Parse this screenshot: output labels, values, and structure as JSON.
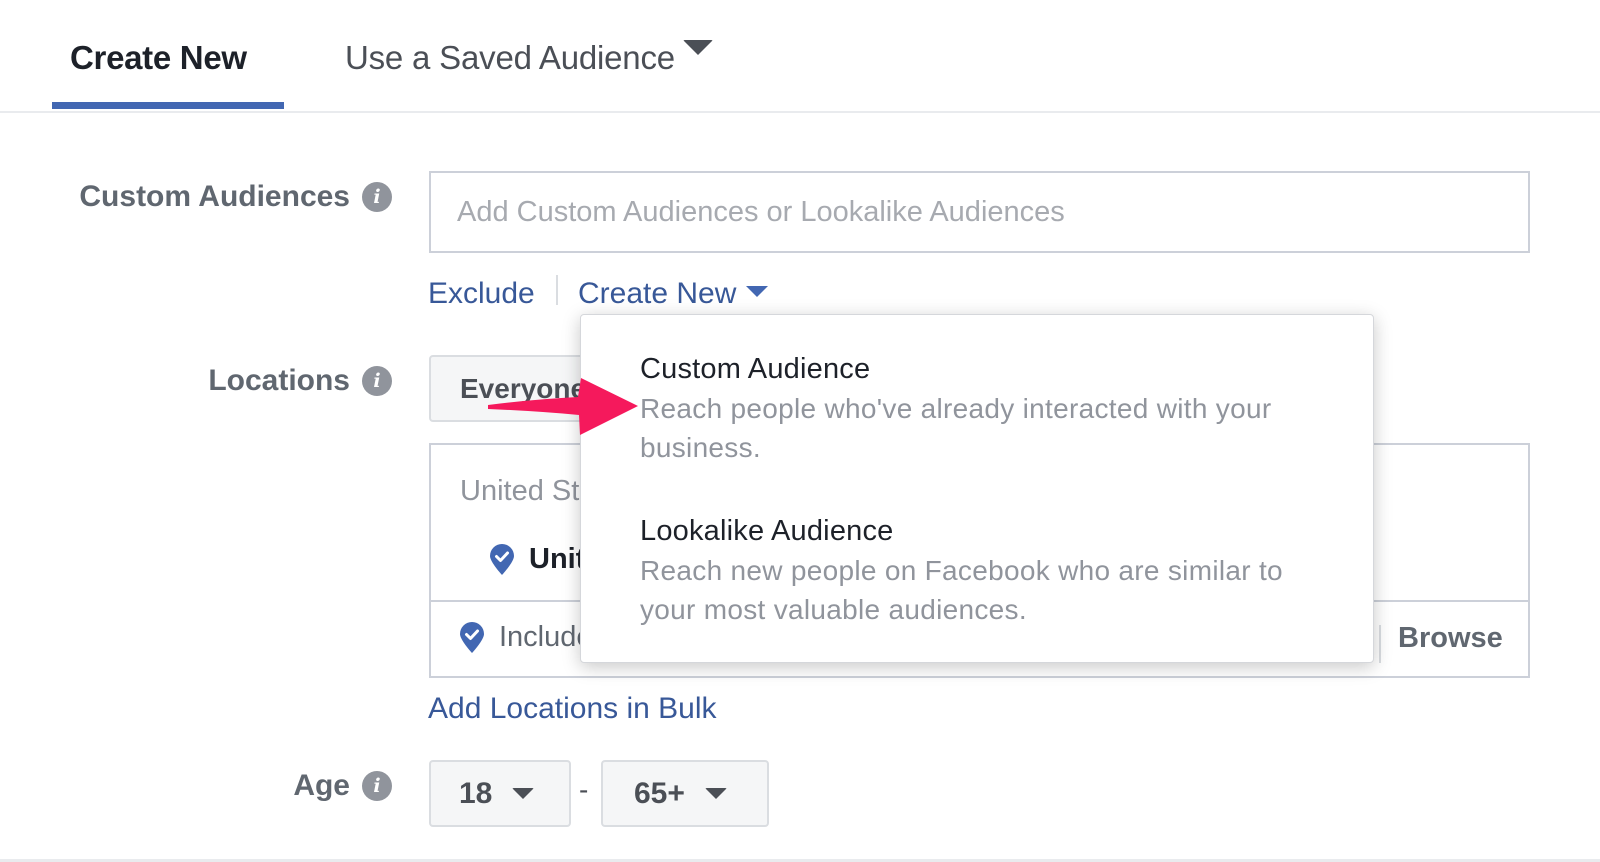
{
  "tabs": {
    "create_new": "Create New",
    "saved_audience": "Use a Saved Audience",
    "active": "create_new"
  },
  "custom_audiences": {
    "label": "Custom Audiences",
    "input_value": "",
    "input_placeholder": "Add Custom Audiences or Lookalike Audiences",
    "exclude_label": "Exclude",
    "create_new_label": "Create New"
  },
  "create_new_menu": {
    "items": [
      {
        "title": "Custom Audience",
        "description": "Reach people who've already interacted with your business."
      },
      {
        "title": "Lookalike Audience",
        "description": "Reach new people on Facebook who are similar to your most valuable audiences."
      }
    ]
  },
  "locations": {
    "label": "Locations",
    "selector_value": "Everyone in this location",
    "header": "United States",
    "selected_location": "United States",
    "include_label": "Include",
    "browse_label": "Browse",
    "bulk_link": "Add Locations in Bulk"
  },
  "age": {
    "label": "Age",
    "min": "18",
    "separator": "-",
    "max": "65+"
  },
  "colors": {
    "accent": "#4267b2",
    "link": "#385898",
    "annotation_arrow": "#f5195c"
  }
}
